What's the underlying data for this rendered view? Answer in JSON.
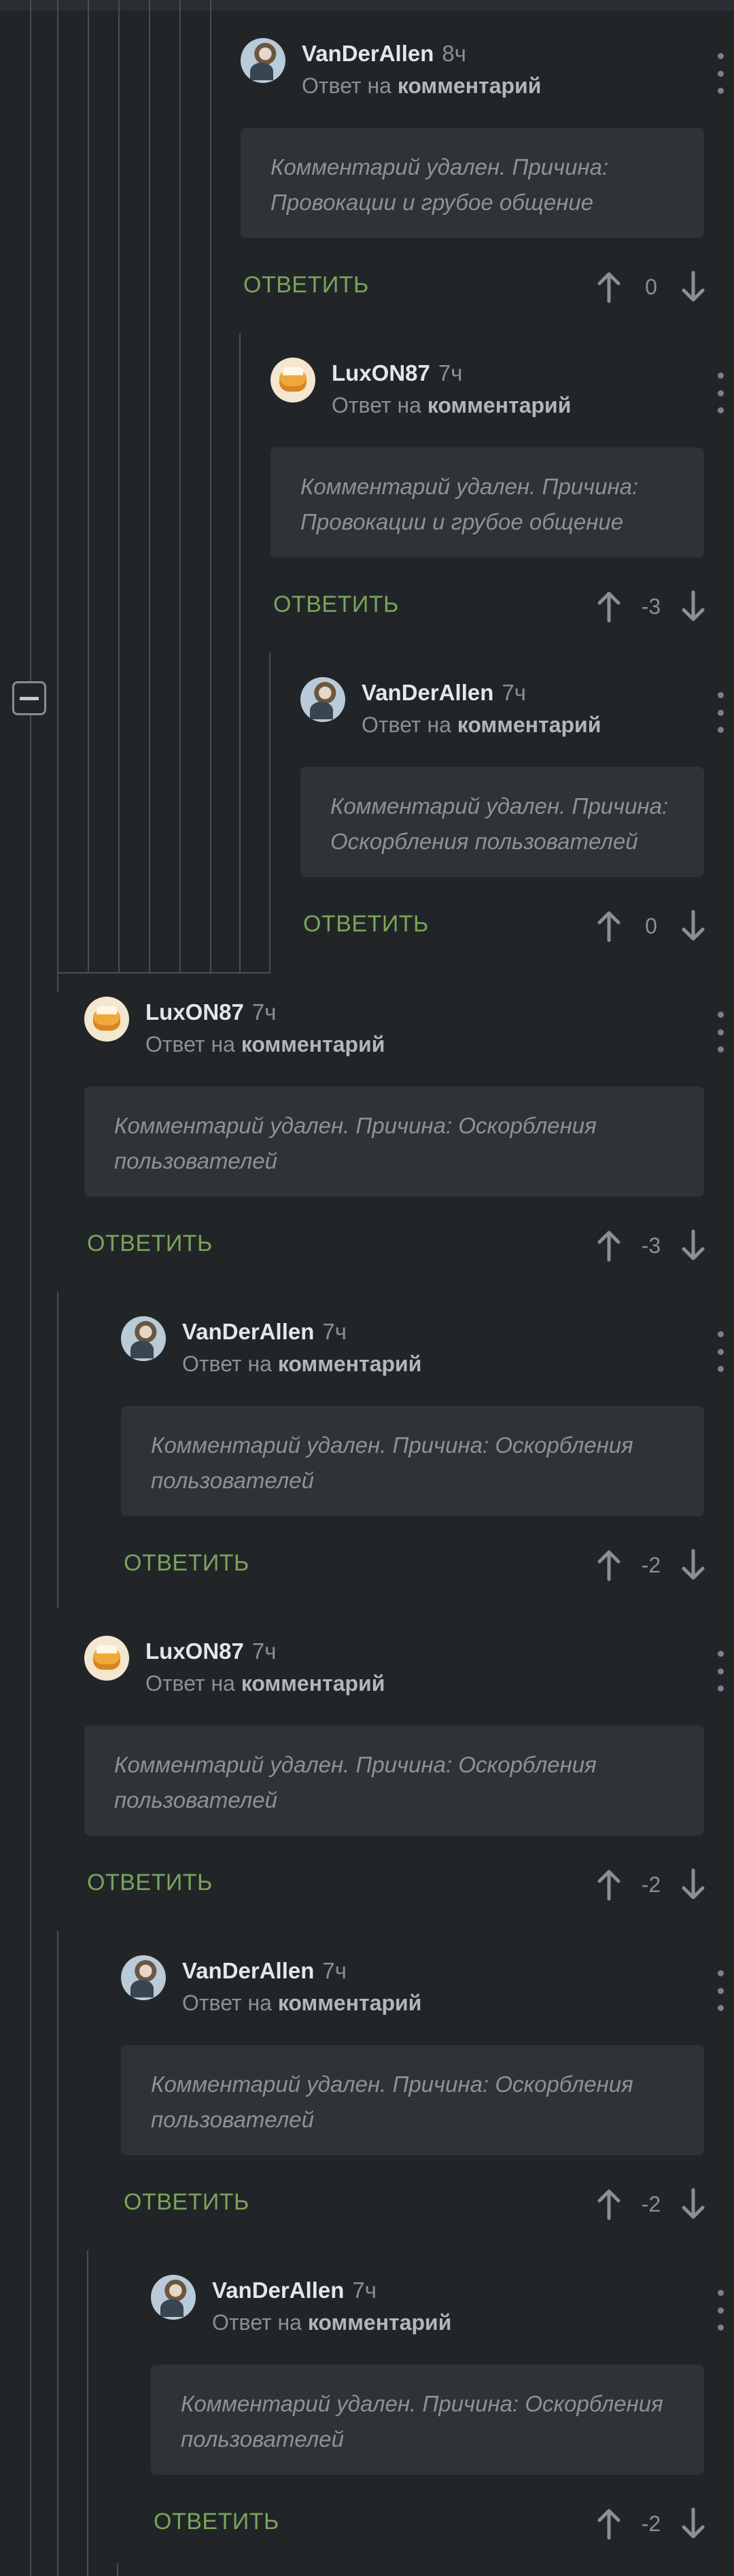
{
  "comments": [
    {
      "author": "VanDerAllen",
      "time": "8ч",
      "reply_prefix": "Ответ на",
      "reply_target": "комментарий",
      "text": "Комментарий удален. Причина: Провокации и грубое общение",
      "answer_label": "ОТВЕТИТЬ",
      "score": "0",
      "avatar": "avatar-vanderallen"
    },
    {
      "author": "LuxON87",
      "time": "7ч",
      "reply_prefix": "Ответ на",
      "reply_target": "комментарий",
      "text": "Комментарий удален. Причина: Провокации и грубое общение",
      "answer_label": "ОТВЕТИТЬ",
      "score": "-3",
      "avatar": "avatar-luxon87"
    },
    {
      "author": "VanDerAllen",
      "time": "7ч",
      "reply_prefix": "Ответ на",
      "reply_target": "комментарий",
      "text": "Комментарий удален. Причина: Оскорбления пользователей",
      "answer_label": "ОТВЕТИТЬ",
      "score": "0",
      "avatar": "avatar-vanderallen"
    },
    {
      "author": "LuxON87",
      "time": "7ч",
      "reply_prefix": "Ответ на",
      "reply_target": "комментарий",
      "text": "Комментарий удален. Причина: Оскорбления пользователей",
      "answer_label": "ОТВЕТИТЬ",
      "score": "-3",
      "avatar": "avatar-luxon87"
    },
    {
      "author": "VanDerAllen",
      "time": "7ч",
      "reply_prefix": "Ответ на",
      "reply_target": "комментарий",
      "text": "Комментарий удален. Причина: Оскорбления пользователей",
      "answer_label": "ОТВЕТИТЬ",
      "score": "-2",
      "avatar": "avatar-vanderallen"
    },
    {
      "author": "LuxON87",
      "time": "7ч",
      "reply_prefix": "Ответ на",
      "reply_target": "комментарий",
      "text": "Комментарий удален. Причина: Оскорбления пользователей",
      "answer_label": "ОТВЕТИТЬ",
      "score": "-2",
      "avatar": "avatar-luxon87"
    },
    {
      "author": "VanDerAllen",
      "time": "7ч",
      "reply_prefix": "Ответ на",
      "reply_target": "комментарий",
      "text": "Комментарий удален. Причина: Оскорбления пользователей",
      "answer_label": "ОТВЕТИТЬ",
      "score": "-2",
      "avatar": "avatar-vanderallen"
    },
    {
      "author": "VanDerAllen",
      "time": "7ч",
      "reply_prefix": "Ответ на",
      "reply_target": "комментарий",
      "text": "Комментарий удален. Причина: Оскорбления пользователей",
      "answer_label": "ОТВЕТИТЬ",
      "score": "-2",
      "avatar": "avatar-vanderallen"
    }
  ],
  "icons": {
    "collapse": "minus-square-icon",
    "upvote": "arrow-up-icon",
    "downvote": "arrow-down-icon",
    "menu": "more-vertical-icon"
  },
  "colors": {
    "background": "#222528",
    "card": "#2f3236",
    "accent": "#78a55a",
    "thread_line": "#4a4d52"
  }
}
